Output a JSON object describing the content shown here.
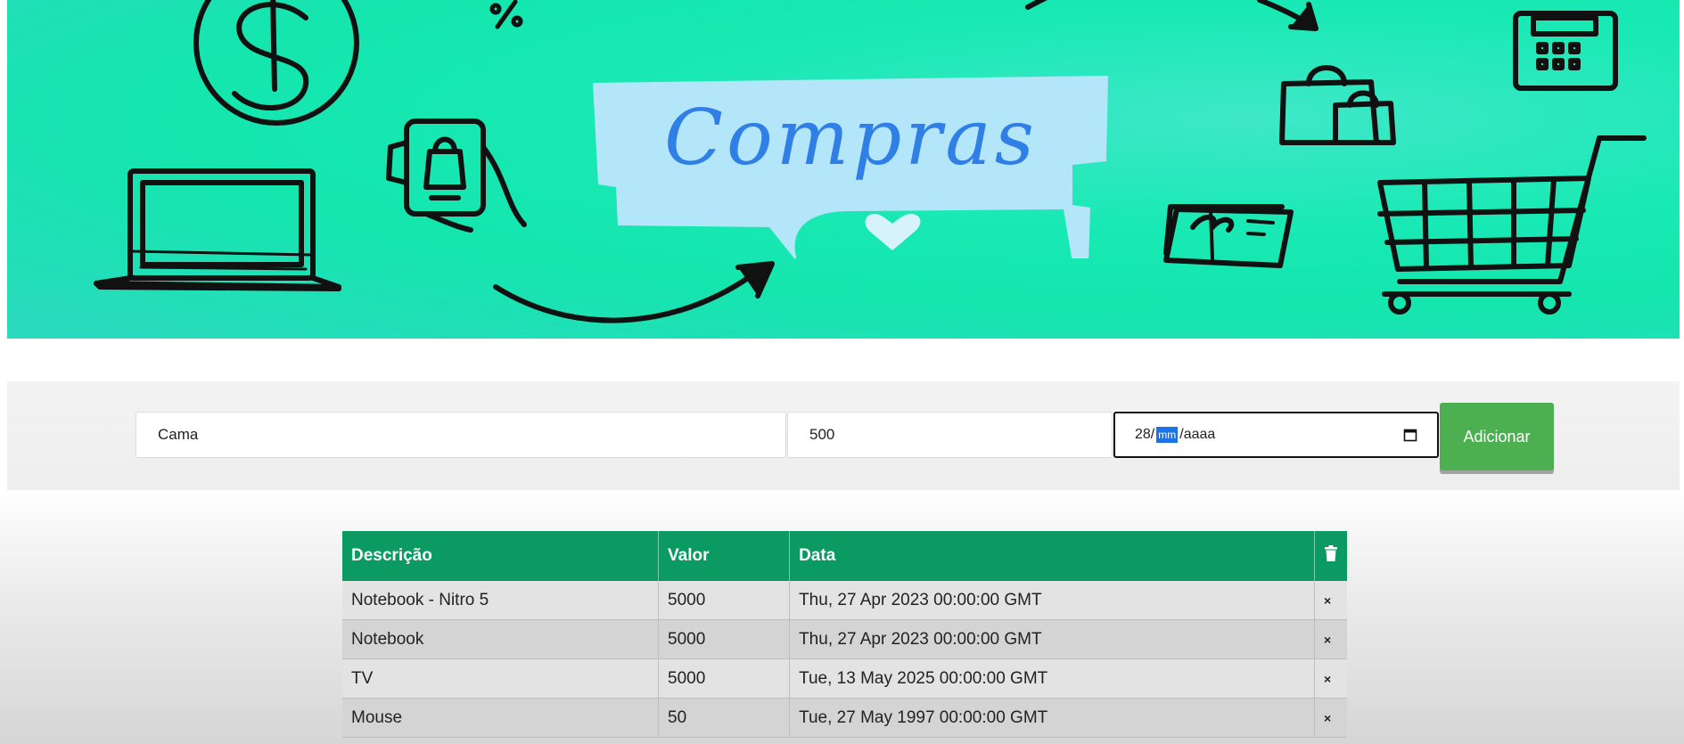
{
  "banner": {
    "title": "Compras"
  },
  "form": {
    "description_value": "Cama",
    "value_value": "500",
    "date_day": "28",
    "date_month": "mm",
    "date_year": "aaaa",
    "add_label": "Adicionar"
  },
  "table": {
    "headers": {
      "descricao": "Descrição",
      "valor": "Valor",
      "data": "Data",
      "delete_icon": "trash-icon"
    },
    "rows": [
      {
        "descricao": "Notebook - Nitro 5",
        "valor": "5000",
        "data": "Thu, 27 Apr 2023 00:00:00 GMT",
        "delete": "×"
      },
      {
        "descricao": "Notebook",
        "valor": "5000",
        "data": "Thu, 27 Apr 2023 00:00:00 GMT",
        "delete": "×"
      },
      {
        "descricao": "TV",
        "valor": "5000",
        "data": "Tue, 13 May 2025 00:00:00 GMT",
        "delete": "×"
      },
      {
        "descricao": "Mouse",
        "valor": "50",
        "data": "Tue, 27 May 1997 00:00:00 GMT",
        "delete": "×"
      }
    ]
  },
  "colors": {
    "banner": "#19e9b4",
    "header": "#0b9a62",
    "button": "#4caf50",
    "title": "#2f7fe6"
  }
}
